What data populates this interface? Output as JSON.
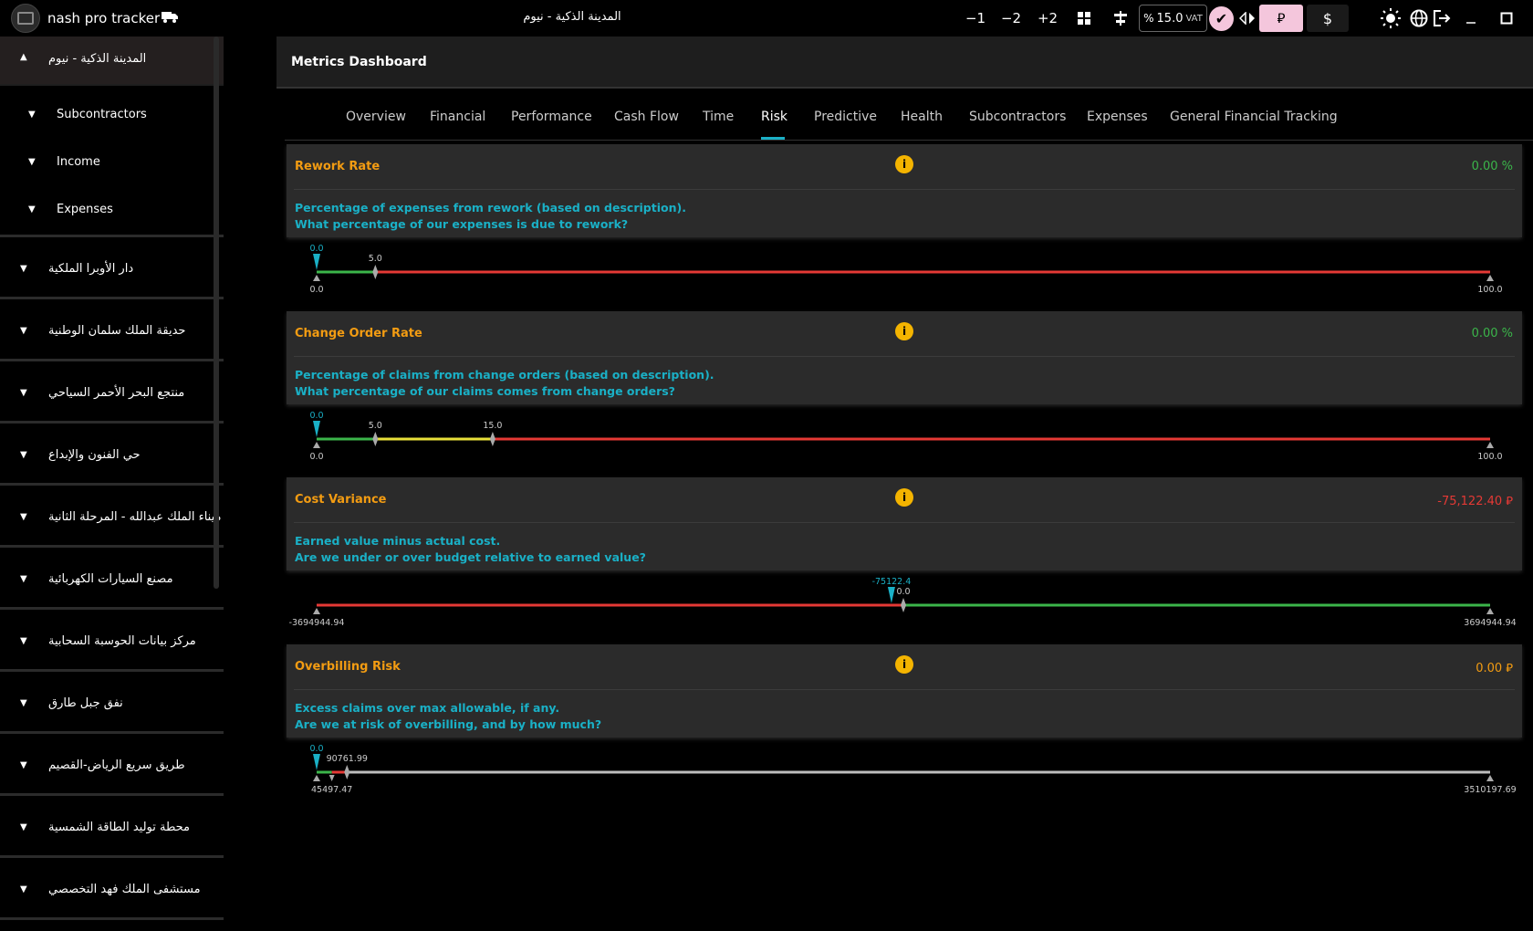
{
  "app": {
    "name": "nash pro tracker",
    "project_title": "المدينة الذكية - نيوم"
  },
  "toolbar": {
    "minus1": "−1",
    "minus2": "−2",
    "plus2": "+2",
    "vat_prefix": "%",
    "vat_value": "15.0",
    "vat_suffix": "VAT",
    "currency_sar": "⃁",
    "currency_usd": "$",
    "icons": [
      "grid-icon",
      "compare-icon",
      "check-icon",
      "swap-icon",
      "sun-icon",
      "globe-icon",
      "logout-icon",
      "minimize-icon",
      "maximize-icon"
    ]
  },
  "sidebar": {
    "active": {
      "label": "المدينة الذكية - نيوم",
      "expanded": true
    },
    "subitems": [
      {
        "label": "Subcontractors"
      },
      {
        "label": "Income"
      },
      {
        "label": "Expenses"
      }
    ],
    "projects": [
      {
        "label": "دار الأوبرا الملكية"
      },
      {
        "label": "حديقة الملك سلمان الوطنية"
      },
      {
        "label": "منتجع البحر الأحمر السياحي"
      },
      {
        "label": "حي الفنون والإبداع"
      },
      {
        "label": "ميناء الملك عبدالله - المرحلة الثانية"
      },
      {
        "label": "مصنع السيارات الكهربائية"
      },
      {
        "label": "مركز بيانات الحوسبة السحابية"
      },
      {
        "label": "نفق جبل طارق"
      },
      {
        "label": "طريق سريع الرياض-القصيم"
      },
      {
        "label": "محطة توليد الطاقة الشمسية"
      },
      {
        "label": "مستشفى الملك فهد التخصصي"
      }
    ]
  },
  "main": {
    "title": "Metrics Dashboard",
    "tabs": [
      {
        "label": "Overview"
      },
      {
        "label": "Financial"
      },
      {
        "label": "Performance"
      },
      {
        "label": "Cash Flow"
      },
      {
        "label": "Time"
      },
      {
        "label": "Risk",
        "active": true
      },
      {
        "label": "Predictive"
      },
      {
        "label": "Health"
      },
      {
        "label": "Subcontractors"
      },
      {
        "label": "Expenses"
      },
      {
        "label": "General Financial Tracking"
      }
    ],
    "metrics": [
      {
        "title": "Rework Rate",
        "value": "0.00 %",
        "value_color": "#3bb54a",
        "desc1": "Percentage of expenses from rework (based on description).",
        "desc2": "What percentage of our expenses is due to rework?",
        "gauge": {
          "min": 0.0,
          "max": 100.0,
          "min_label": "0.0",
          "max_label": "100.0",
          "current": 0.0,
          "current_label": "0.0",
          "segments": [
            {
              "from": 0,
              "to": 5,
              "color": "#3bb54a"
            },
            {
              "from": 5,
              "to": 100,
              "color": "#e53935"
            }
          ],
          "thresholds": [
            {
              "value": 5.0,
              "label": "5.0"
            }
          ]
        }
      },
      {
        "title": "Change Order Rate",
        "value": "0.00 %",
        "value_color": "#3bb54a",
        "desc1": "Percentage of claims from change orders (based on description).",
        "desc2": "What percentage of our claims comes from change orders?",
        "gauge": {
          "min": 0.0,
          "max": 100.0,
          "min_label": "0.0",
          "max_label": "100.0",
          "current": 0.0,
          "current_label": "0.0",
          "segments": [
            {
              "from": 0,
              "to": 5,
              "color": "#3bb54a"
            },
            {
              "from": 5,
              "to": 15,
              "color": "#e8e03a"
            },
            {
              "from": 15,
              "to": 100,
              "color": "#e53935"
            }
          ],
          "thresholds": [
            {
              "value": 5.0,
              "label": "5.0"
            },
            {
              "value": 15.0,
              "label": "15.0"
            }
          ]
        }
      },
      {
        "title": "Cost Variance",
        "value": "-75,122.40 ⃁",
        "value_color": "#e53935",
        "desc1": "Earned value minus actual cost.",
        "desc2": "Are we under or over budget relative to earned value?",
        "gauge": {
          "min": -3694944.94,
          "max": 3694944.94,
          "min_label": "-3694944.94",
          "max_label": "3694944.94",
          "current": -75122.4,
          "current_label": "-75122.4",
          "segments": [
            {
              "from": -3694944.94,
              "to": 0,
              "color": "#e53935"
            },
            {
              "from": 0,
              "to": 3694944.94,
              "color": "#3bb54a"
            }
          ],
          "thresholds": [
            {
              "value": 0.0,
              "label": "0.0"
            }
          ]
        }
      },
      {
        "title": "Overbilling Risk",
        "value": "0.00 ⃁",
        "value_color": "#f39c12",
        "desc1": "Excess claims over max allowable, if any.",
        "desc2": "Are we at risk of overbilling, and by how much?",
        "gauge": {
          "min": 0.0,
          "max": 3510197.69,
          "min_label": "",
          "max_label": "3510197.69",
          "current": 0.0,
          "current_label": "0.0",
          "segments": [
            {
              "from": 0,
              "to": 45497.47,
              "color": "#3bb54a"
            },
            {
              "from": 45497.47,
              "to": 90761.99,
              "color": "#e53935"
            },
            {
              "from": 90761.99,
              "to": 3510197.69,
              "color": "#bdbdbd"
            }
          ],
          "thresholds": [
            {
              "value": 45497.47,
              "label": "45497.47",
              "below": true
            },
            {
              "value": 90761.99,
              "label": "90761.99"
            }
          ]
        }
      }
    ]
  }
}
